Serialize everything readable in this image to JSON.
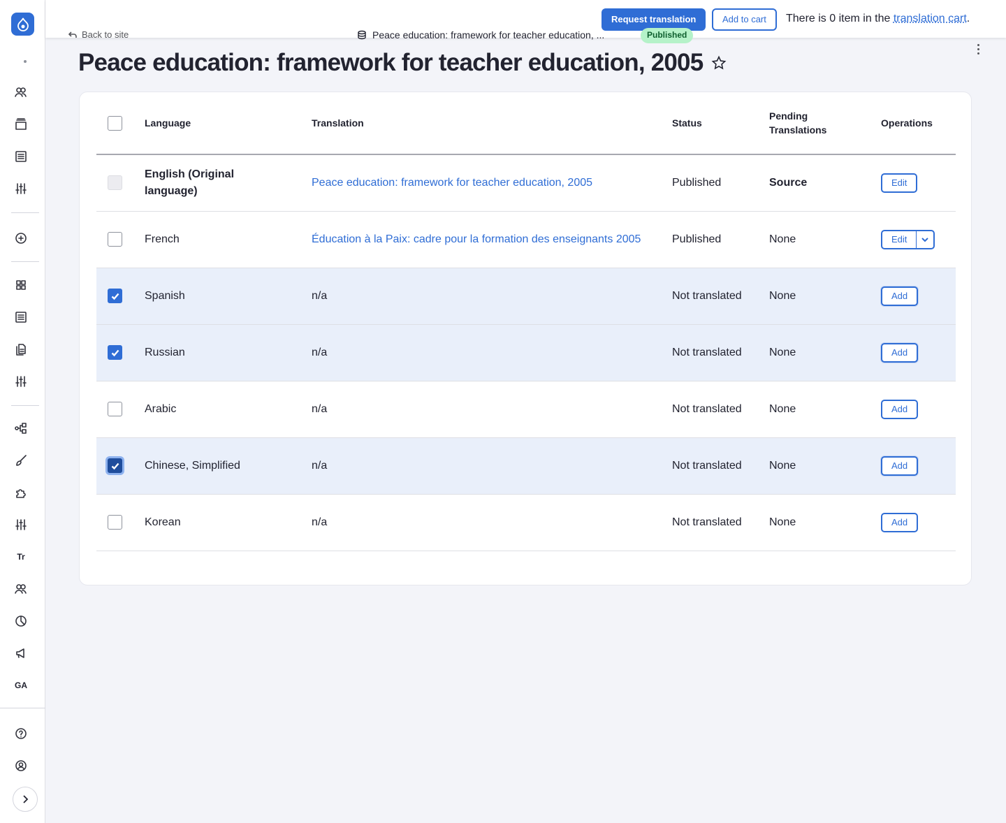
{
  "topbar": {
    "back_label": "Back to site",
    "node_title": "Peace education: framework for teacher education, ...",
    "status_badge": "Published",
    "request_button": "Request translation",
    "add_cart_button": "Add to cart",
    "cart_text_prefix": "There is 0 item in the ",
    "cart_link": "translation cart",
    "cart_text_suffix": "."
  },
  "page": {
    "title": "Peace education: framework for teacher education, 2005"
  },
  "sidebar": {
    "text_items": {
      "tr": "Tr",
      "ga": "GA"
    }
  },
  "table": {
    "headers": {
      "language": "Language",
      "translation": "Translation",
      "status": "Status",
      "pending": "Pending Translations",
      "operations": "Operations"
    },
    "rows": [
      {
        "language": "English (Original language)",
        "translation": "Peace education: framework for teacher education, 2005",
        "status": "Published",
        "pending": "Source",
        "operation": "Edit"
      },
      {
        "language": "French",
        "translation": "Éducation à la Paix: cadre pour la formation des enseignants 2005",
        "status": "Published",
        "pending": "None",
        "operation": "Edit"
      },
      {
        "language": "Spanish",
        "translation": "n/a",
        "status": "Not translated",
        "pending": "None",
        "operation": "Add"
      },
      {
        "language": "Russian",
        "translation": "n/a",
        "status": "Not translated",
        "pending": "None",
        "operation": "Add"
      },
      {
        "language": "Arabic",
        "translation": "n/a",
        "status": "Not translated",
        "pending": "None",
        "operation": "Add"
      },
      {
        "language": "Chinese, Simplified",
        "translation": "n/a",
        "status": "Not translated",
        "pending": "None",
        "operation": "Add"
      },
      {
        "language": "Korean",
        "translation": "n/a",
        "status": "Not translated",
        "pending": "None",
        "operation": "Add"
      }
    ]
  },
  "colors": {
    "accent": "#2f6dd5",
    "selected_row": "#e9effa",
    "badge_bg": "#b5f2c9"
  }
}
